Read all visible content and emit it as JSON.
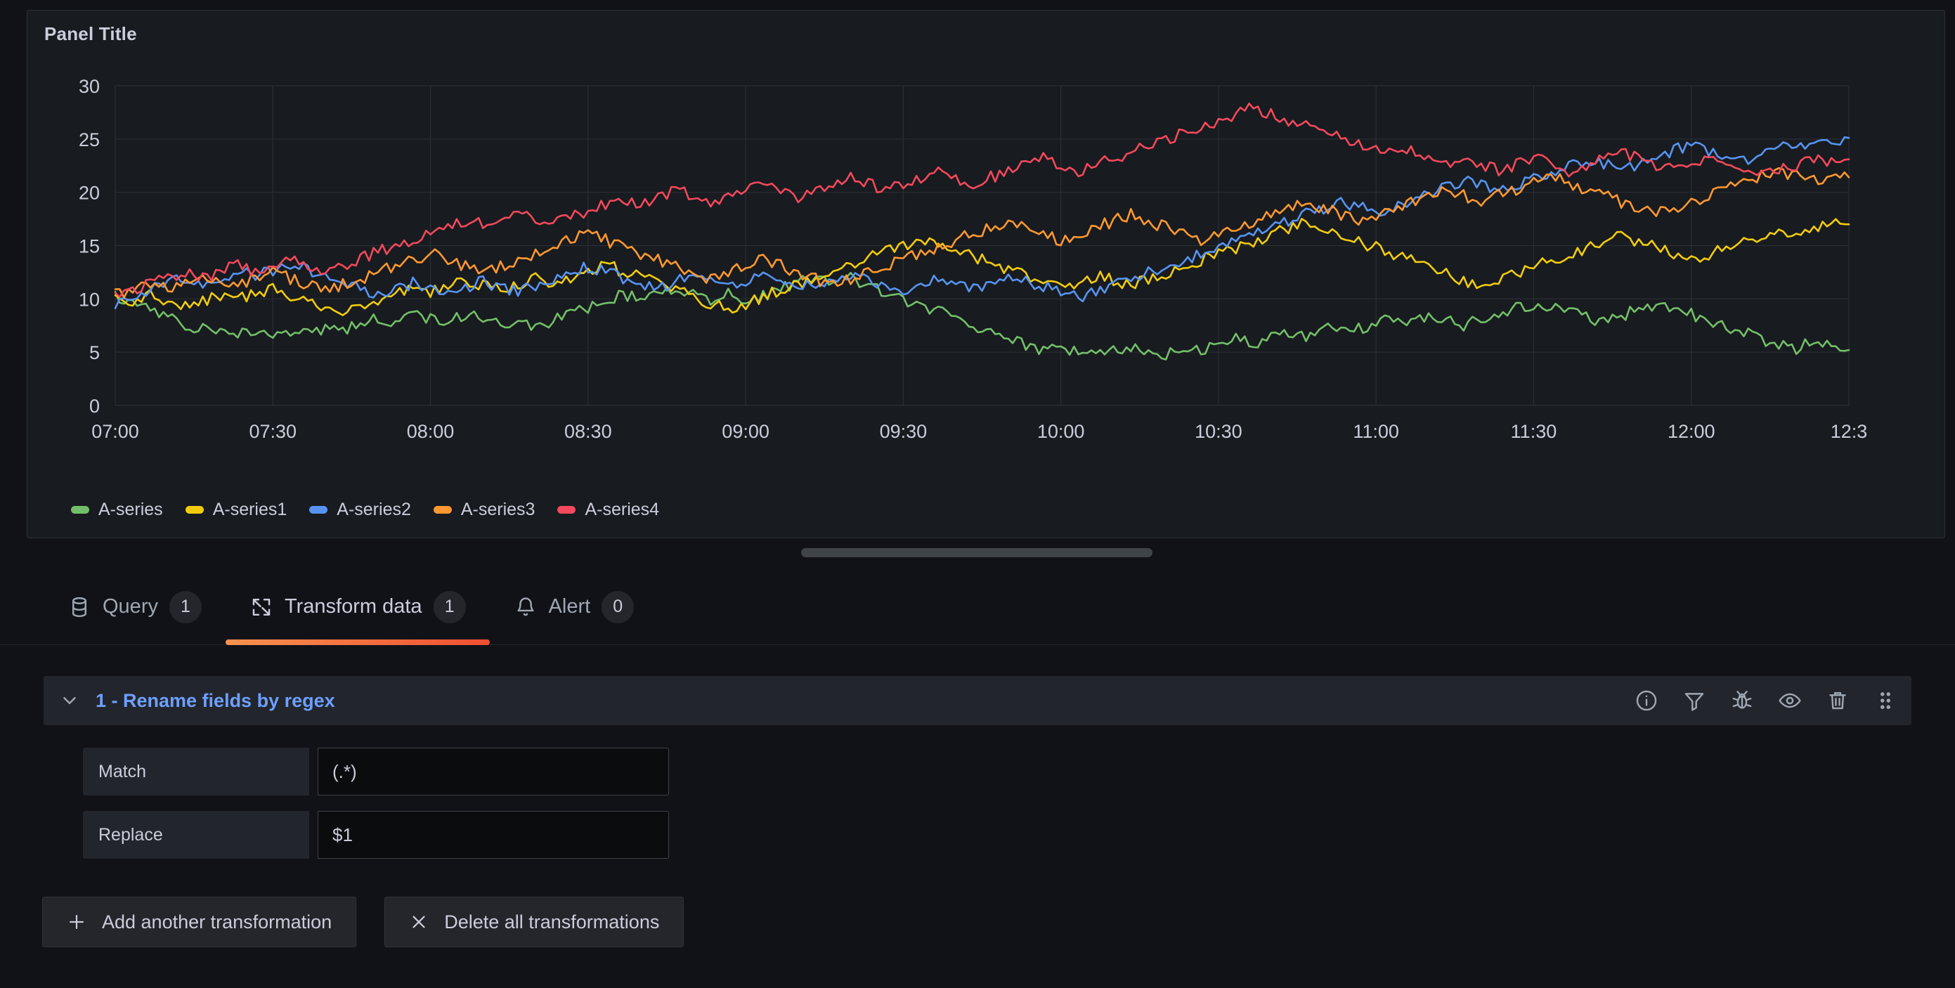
{
  "panel": {
    "title": "Panel Title"
  },
  "chart_data": {
    "type": "line",
    "title": "Panel Title",
    "xlabel": "",
    "ylabel": "",
    "ylim": [
      0,
      30
    ],
    "y_ticks": [
      30,
      25,
      20,
      15,
      10,
      5,
      0
    ],
    "x_ticks": [
      "07:00",
      "07:30",
      "08:00",
      "08:30",
      "09:00",
      "09:30",
      "10:00",
      "10:30",
      "11:00",
      "11:30",
      "12:00",
      "12:3"
    ],
    "grid": true,
    "legend_position": "bottom",
    "colors": {
      "green": "#73bf69",
      "yellow": "#f2cc0c",
      "blue": "#5794f2",
      "orange": "#ff9830",
      "red": "#f2495c"
    },
    "series": [
      {
        "name": "A-series",
        "color": "#73bf69",
        "values": [
          10.2,
          9.6,
          9.1,
          8.3,
          7.6,
          7.2,
          7.0,
          6.8,
          7.1,
          6.6,
          6.4,
          6.9,
          7.3,
          7.0,
          7.6,
          8.1,
          7.8,
          8.4,
          8.2,
          7.9,
          8.6,
          8.2,
          7.7,
          8.0,
          7.5,
          7.9,
          8.6,
          9.2,
          9.8,
          10.4,
          9.9,
          10.6,
          11.1,
          10.5,
          9.9,
          10.4,
          9.8,
          10.3,
          11.0,
          11.6,
          12.1,
          11.5,
          11.9,
          11.2,
          10.6,
          10.0,
          9.4,
          8.8,
          8.1,
          7.4,
          6.8,
          6.2,
          5.6,
          5.1,
          5.5,
          4.9,
          4.6,
          5.1,
          5.6,
          5.2,
          4.8,
          5.4,
          5.1,
          5.7,
          6.2,
          5.8,
          6.4,
          7.0,
          6.5,
          7.1,
          7.7,
          7.2,
          7.8,
          8.3,
          7.9,
          8.5,
          8.0,
          7.5,
          8.1,
          8.7,
          9.3,
          8.8,
          9.4,
          8.9,
          8.3,
          7.8,
          8.4,
          9.0,
          9.6,
          9.1,
          8.6,
          8.0,
          7.4,
          6.8,
          6.2,
          5.8,
          5.4,
          5.9,
          5.5,
          5.2
        ]
      },
      {
        "name": "A-series1",
        "color": "#f2cc0c",
        "values": [
          10.0,
          9.8,
          10.3,
          9.7,
          9.2,
          9.8,
          10.4,
          9.9,
          10.5,
          11.0,
          10.4,
          9.8,
          9.2,
          8.7,
          9.3,
          9.9,
          10.5,
          11.1,
          10.6,
          11.2,
          11.8,
          11.3,
          10.8,
          11.4,
          12.0,
          11.5,
          12.1,
          12.7,
          13.2,
          12.6,
          12.0,
          11.4,
          10.8,
          10.2,
          9.6,
          9.0,
          9.6,
          10.2,
          10.8,
          11.4,
          12.0,
          12.6,
          13.2,
          13.8,
          14.4,
          15.0,
          15.5,
          15.0,
          14.5,
          14.0,
          13.4,
          12.8,
          12.2,
          11.6,
          11.0,
          11.6,
          12.2,
          11.7,
          11.2,
          11.8,
          12.4,
          13.0,
          13.6,
          14.2,
          14.8,
          15.4,
          16.0,
          16.6,
          17.2,
          16.6,
          16.0,
          15.4,
          14.8,
          14.2,
          13.6,
          13.0,
          12.4,
          11.8,
          11.2,
          11.8,
          12.4,
          13.0,
          13.6,
          14.2,
          14.8,
          15.4,
          16.0,
          15.4,
          14.8,
          14.2,
          13.6,
          14.2,
          14.8,
          15.4,
          16.0,
          16.6,
          16.2,
          16.8,
          17.2,
          17.0
        ]
      },
      {
        "name": "A-series2",
        "color": "#5794f2",
        "values": [
          9.6,
          10.2,
          10.8,
          11.4,
          12.0,
          11.4,
          12.0,
          12.6,
          12.1,
          12.7,
          13.3,
          12.8,
          12.2,
          11.6,
          11.0,
          10.4,
          10.9,
          11.5,
          11.0,
          10.5,
          11.1,
          11.6,
          11.1,
          10.6,
          11.2,
          11.8,
          12.4,
          13.0,
          12.5,
          12.0,
          11.5,
          11.0,
          11.6,
          12.2,
          11.7,
          11.2,
          11.8,
          12.4,
          12.0,
          11.5,
          11.0,
          11.6,
          12.2,
          11.7,
          11.2,
          10.7,
          11.3,
          11.9,
          11.4,
          10.9,
          11.5,
          12.1,
          11.6,
          11.1,
          10.6,
          10.1,
          10.7,
          11.3,
          11.9,
          12.5,
          13.1,
          13.7,
          14.3,
          14.9,
          15.5,
          16.1,
          16.7,
          17.3,
          17.9,
          18.5,
          19.1,
          18.6,
          18.1,
          18.7,
          19.3,
          19.9,
          20.5,
          21.1,
          20.6,
          20.1,
          20.7,
          21.3,
          21.9,
          22.5,
          23.1,
          22.6,
          22.1,
          22.7,
          23.3,
          23.9,
          24.5,
          23.9,
          23.4,
          22.9,
          23.5,
          24.1,
          24.7,
          24.2,
          24.8,
          25.1
        ]
      },
      {
        "name": "A-series3",
        "color": "#ff9830",
        "values": [
          10.4,
          11.0,
          11.6,
          11.1,
          11.7,
          12.3,
          11.8,
          11.3,
          11.9,
          12.5,
          11.9,
          11.3,
          10.7,
          11.3,
          11.9,
          12.5,
          13.1,
          13.7,
          14.3,
          13.7,
          13.1,
          12.5,
          13.1,
          13.7,
          14.3,
          14.9,
          15.5,
          16.1,
          15.5,
          14.9,
          14.3,
          13.7,
          13.1,
          12.5,
          11.9,
          12.5,
          13.1,
          13.7,
          13.1,
          12.5,
          11.9,
          11.3,
          11.9,
          12.5,
          13.1,
          13.7,
          14.3,
          14.9,
          15.5,
          16.1,
          16.7,
          17.3,
          16.7,
          16.1,
          15.5,
          16.1,
          16.7,
          17.3,
          17.9,
          17.3,
          16.7,
          16.1,
          15.5,
          16.1,
          16.7,
          17.3,
          17.9,
          18.5,
          19.1,
          18.5,
          17.9,
          17.3,
          17.9,
          18.5,
          19.1,
          19.7,
          20.3,
          19.7,
          19.1,
          19.7,
          20.3,
          20.9,
          21.5,
          20.9,
          20.3,
          19.7,
          19.1,
          18.5,
          17.9,
          18.5,
          19.1,
          19.7,
          20.3,
          20.9,
          21.5,
          22.1,
          21.5,
          21.0,
          21.6,
          21.4
        ]
      },
      {
        "name": "A-series4",
        "color": "#f2495c",
        "values": [
          10.2,
          10.8,
          11.4,
          12.0,
          12.6,
          12.0,
          12.6,
          13.2,
          12.6,
          13.2,
          13.8,
          13.2,
          12.6,
          13.2,
          13.8,
          14.4,
          15.0,
          15.6,
          16.2,
          16.8,
          17.4,
          17.0,
          17.6,
          18.2,
          17.6,
          17.0,
          17.6,
          18.2,
          18.8,
          19.4,
          19.0,
          19.6,
          20.2,
          19.6,
          19.0,
          19.6,
          20.2,
          20.8,
          20.2,
          19.6,
          20.2,
          20.8,
          21.4,
          20.8,
          20.2,
          20.8,
          21.4,
          22.0,
          21.4,
          20.8,
          21.4,
          22.0,
          22.6,
          23.2,
          22.6,
          22.0,
          22.6,
          23.2,
          23.8,
          24.4,
          25.0,
          25.6,
          26.2,
          26.8,
          27.4,
          28.0,
          27.4,
          26.8,
          26.2,
          25.6,
          25.0,
          24.4,
          23.8,
          24.4,
          23.8,
          23.2,
          22.6,
          23.2,
          22.6,
          22.0,
          22.6,
          23.2,
          22.6,
          22.0,
          22.6,
          23.2,
          23.8,
          23.2,
          22.6,
          22.0,
          22.6,
          23.2,
          22.6,
          22.0,
          21.4,
          22.0,
          22.6,
          23.2,
          22.7,
          23.1
        ]
      }
    ]
  },
  "tabs": [
    {
      "label": "Query",
      "badge": "1",
      "icon": "database-icon",
      "active": false
    },
    {
      "label": "Transform data",
      "badge": "1",
      "icon": "transform-icon",
      "active": true
    },
    {
      "label": "Alert",
      "badge": "0",
      "icon": "bell-icon",
      "active": false
    }
  ],
  "transformation": {
    "title": "1 - Rename fields by regex",
    "collapse_icon": "chevron-down-icon",
    "actions": [
      {
        "name": "info-icon"
      },
      {
        "name": "filter-icon"
      },
      {
        "name": "debug-icon"
      },
      {
        "name": "eye-icon"
      },
      {
        "name": "trash-icon"
      },
      {
        "name": "drag-handle-icon"
      }
    ],
    "options": [
      {
        "label": "Match",
        "value": "(.*)"
      },
      {
        "label": "Replace",
        "value": "$1"
      }
    ]
  },
  "buttons": [
    {
      "label": "Add another transformation",
      "glyph": "plus-icon"
    },
    {
      "label": "Delete all transformations",
      "glyph": "close-icon"
    }
  ],
  "theme": {
    "accent": "#ff8833",
    "link": "#6e9fff",
    "page_bg": "#111217",
    "panel_bg": "#181b1f",
    "text": "#ccccdc"
  }
}
